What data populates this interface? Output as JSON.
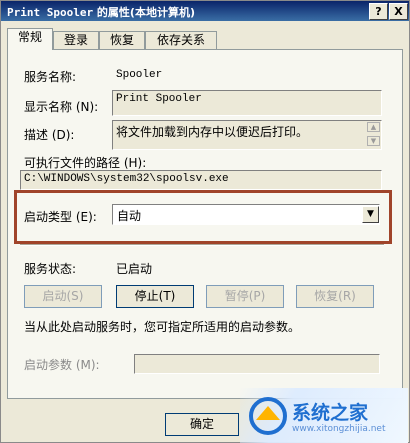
{
  "window": {
    "title_mono": "Print Spooler",
    "title_rest": " 的属性(本地计算机)",
    "help_btn": "?",
    "close_btn": "X"
  },
  "tabs": [
    {
      "label": "常规"
    },
    {
      "label": "登录"
    },
    {
      "label": "恢复"
    },
    {
      "label": "依存关系"
    }
  ],
  "service_name_label": "服务名称:",
  "service_name": "Spooler",
  "display_name_label": "显示名称 (N):",
  "display_name": "Print Spooler",
  "description_label": "描述 (D):",
  "description": "将文件加载到内存中以便迟后打印。",
  "exe_path_label": "可执行文件的路径 (H):",
  "exe_path": "C:\\WINDOWS\\system32\\spoolsv.exe",
  "startup_type_label": "启动类型 (E):",
  "startup_type": "自动",
  "status_label": "服务状态:",
  "status": "已启动",
  "buttons": {
    "start": "启动(S)",
    "stop": "停止(T)",
    "pause": "暂停(P)",
    "resume": "恢复(R)"
  },
  "hint": "当从此处启动服务时，您可指定所适用的启动参数。",
  "params_label": "启动参数 (M):",
  "params_value": "",
  "ok": "确定",
  "watermark": {
    "brand": "系统之家",
    "url": "www.xitongzhijia.net"
  },
  "colors": {
    "highlight": "#a0442a",
    "titlebar": "#0a246a",
    "watermark_text": "#1f6fd0"
  }
}
